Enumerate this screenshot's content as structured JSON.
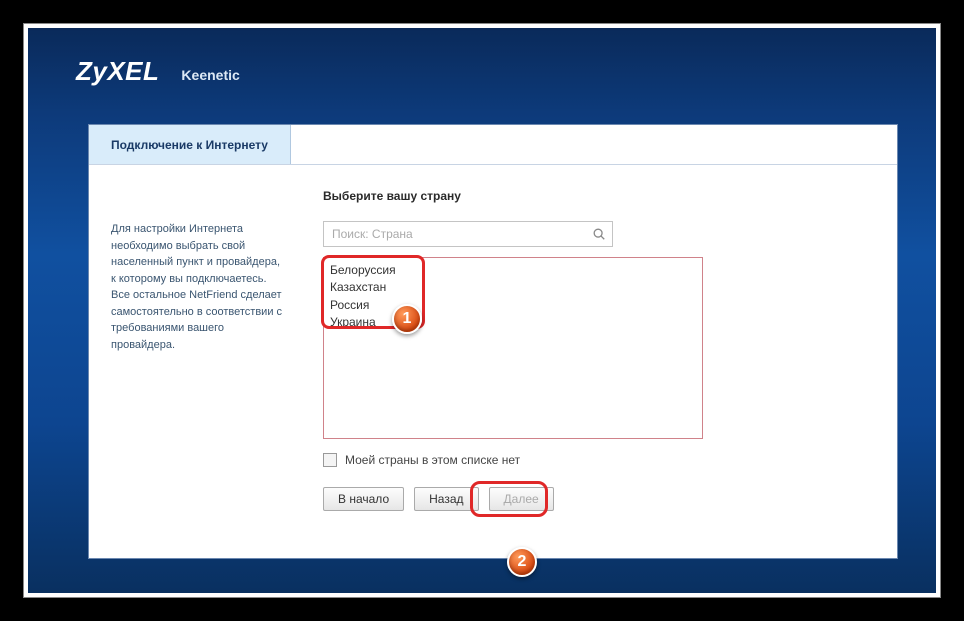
{
  "brand": "ZyXEL",
  "product": "Keenetic",
  "tab_label": "Подключение к Интернету",
  "help_text": "Для настройки Интернета необходимо выбрать свой населенный пункт и провайдера, к которому вы подключаетесь. Все остальное NetFriend сделает самостоятельно в соответствии с требованиями вашего провайдера.",
  "section_title": "Выберите вашу страну",
  "search": {
    "placeholder": "Поиск: Страна"
  },
  "countries": [
    "Белоруссия",
    "Казахстан",
    "Россия",
    "Украина"
  ],
  "not_in_list_label": "Моей страны в этом списке нет",
  "buttons": {
    "home": "В начало",
    "back": "Назад",
    "next": "Далее"
  },
  "markers": {
    "one": "1",
    "two": "2"
  }
}
